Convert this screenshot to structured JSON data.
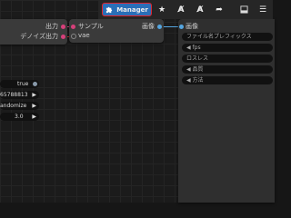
{
  "toolbar": {
    "manager_label": "Manager",
    "icons": [
      "puzzle-icon",
      "star-icon",
      "font-a-icon",
      "font-a-2-icon",
      "share-arrow-icon",
      "panel-icon",
      "hamburger-menu-icon"
    ]
  },
  "left_node": {
    "outputs": [
      "出力",
      "デノイズ出力"
    ]
  },
  "mid_node": {
    "sample_label": "サンプル",
    "vae_label": "vae",
    "image_out_label": "画像"
  },
  "right_node": {
    "image_in_label": "画像",
    "fields": [
      {
        "label": "ファイル名プレフィックス"
      },
      {
        "label": "◀ fps"
      },
      {
        "label": "ロスレス"
      },
      {
        "label": "◀ 品質"
      },
      {
        "label": "◀ 方法"
      }
    ]
  },
  "left_widgets": [
    {
      "value": "true"
    },
    {
      "value": "65788813"
    },
    {
      "value": "andomize"
    },
    {
      "value": "3.0"
    }
  ],
  "colors": {
    "accent_blue": "#2a6fb8",
    "highlight_red": "#e0242c",
    "link_pink": "#d6407a",
    "link_blue": "#55a6e0"
  }
}
